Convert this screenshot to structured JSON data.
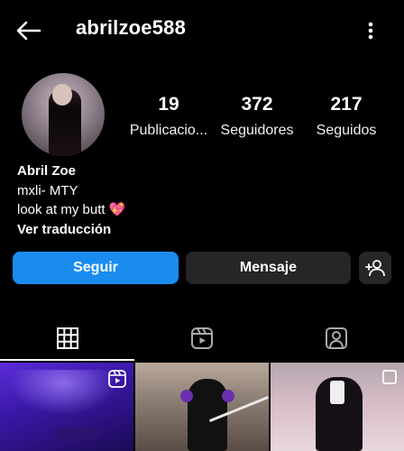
{
  "header": {
    "username": "abrilzoe588"
  },
  "stats": [
    {
      "value": "19",
      "label": "Publicacio..."
    },
    {
      "value": "372",
      "label": "Seguidores"
    },
    {
      "value": "217",
      "label": "Seguidos"
    }
  ],
  "bio": {
    "name": "Abril Zoe",
    "line1": "mxli- MTY",
    "line2": "look at my butt",
    "emoji": "💖",
    "translate": "Ver traducción"
  },
  "actions": {
    "follow": "Seguir",
    "message": "Mensaje"
  },
  "colors": {
    "accent": "#1a8cf0",
    "secondary_button": "#262626",
    "background": "#000000"
  },
  "icons": {
    "back": "arrow-left-icon",
    "more": "more-vertical-icon",
    "add_user": "add-person-icon",
    "grid": "grid-icon",
    "reels": "reels-icon",
    "tagged": "tagged-person-icon"
  }
}
